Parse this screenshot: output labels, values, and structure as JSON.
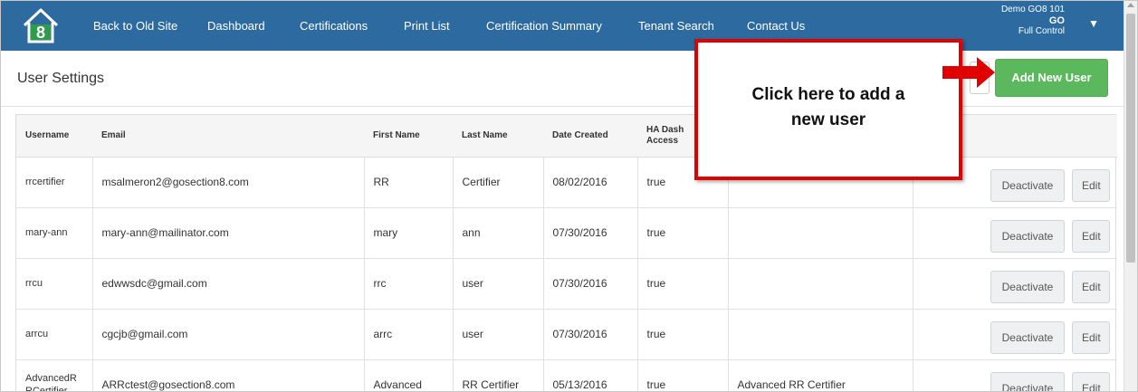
{
  "navbar": {
    "logo_text": "8",
    "links": [
      "Back to Old Site",
      "Dashboard",
      "Certifications",
      "Print List",
      "Certification Summary",
      "Tenant Search",
      "Contact Us"
    ],
    "account_name": "Demo GO8 101",
    "account_short": "GO",
    "account_role": "Full Control",
    "caret": "▼"
  },
  "page": {
    "title": "User Settings",
    "add_button_label": "Add New User"
  },
  "callout": {
    "line1": "Click here to add a",
    "line2": "new user"
  },
  "table": {
    "headers": [
      "Username",
      "Email",
      "First Name",
      "Last Name",
      "Date Created",
      "HA Dash\nAccess",
      ""
    ],
    "rows": [
      {
        "username": "rrcertifier",
        "email": "msalmeron2@gosection8.com",
        "first": "RR",
        "last": "Certifier",
        "created": "08/02/2016",
        "access": "true",
        "role": ""
      },
      {
        "username": "mary-ann",
        "email": "mary-ann@mailinator.com",
        "first": "mary",
        "last": "ann",
        "created": "07/30/2016",
        "access": "true",
        "role": ""
      },
      {
        "username": "rrcu",
        "email": "edwwsdc@gmail.com",
        "first": "rrc",
        "last": "user",
        "created": "07/30/2016",
        "access": "true",
        "role": ""
      },
      {
        "username": "arrcu",
        "email": "cgcjb@gmail.com",
        "first": "arrc",
        "last": "user",
        "created": "07/30/2016",
        "access": "true",
        "role": ""
      },
      {
        "username": "AdvancedRRCertifier",
        "email": "ARRctest@gosection8.com",
        "first": "Advanced",
        "last": "RR Certifier",
        "created": "05/13/2016",
        "access": "true",
        "role": "Advanced RR Certifier"
      }
    ],
    "deactivate_label": "Deactivate",
    "edit_label": "Edit"
  },
  "colors": {
    "navbar": "#2c6aa0",
    "add_button": "#5cb85c",
    "callout_border": "#e00000"
  }
}
